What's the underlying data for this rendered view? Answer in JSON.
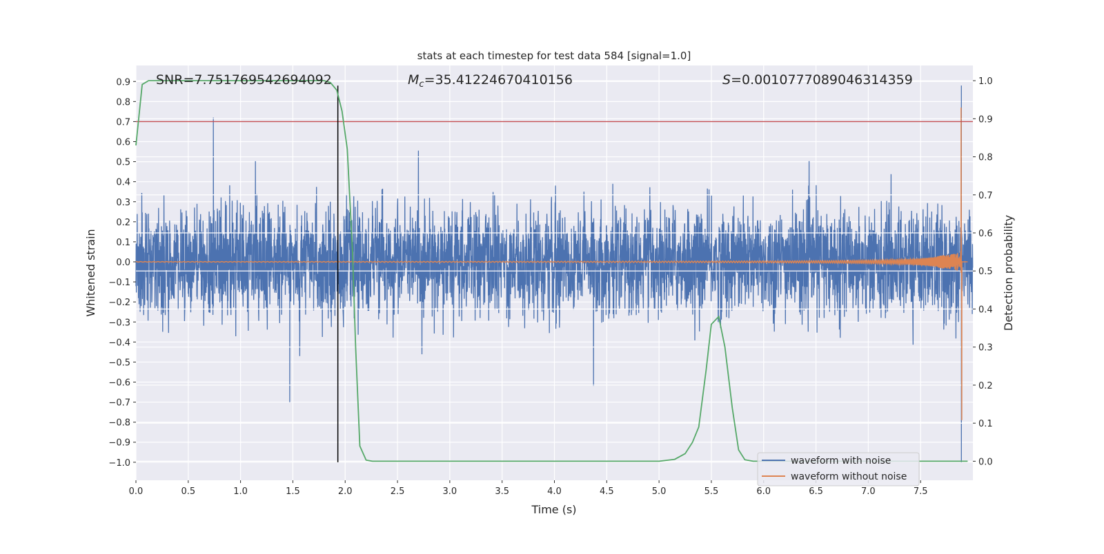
{
  "chart_data": {
    "type": "line",
    "title": "stats at each timestep for test data 584 [signal=1.0]",
    "xlabel": "Time (s)",
    "ylabel": "Whitened strain",
    "ylabel_right": "Detection probability",
    "xlim": [
      0,
      8
    ],
    "ylim": [
      -1.09,
      0.98
    ],
    "ylim_right": [
      -0.05,
      1.04
    ],
    "grid": true,
    "legend_position": "lower-right",
    "x_ticks": [
      "0.0",
      "0.5",
      "1.0",
      "1.5",
      "2.0",
      "2.5",
      "3.0",
      "3.5",
      "4.0",
      "4.5",
      "5.0",
      "5.5",
      "6.0",
      "6.5",
      "7.0",
      "7.5"
    ],
    "y_ticks": [
      "0.9",
      "0.8",
      "0.7",
      "0.6",
      "0.5",
      "0.4",
      "0.3",
      "0.2",
      "0.1",
      "0.0",
      "−0.1",
      "−0.2",
      "−0.3",
      "−0.4",
      "−0.5",
      "−0.6",
      "−0.7",
      "−0.8",
      "−0.9",
      "−1.0"
    ],
    "y_ticks_right": [
      "1.0",
      "0.9",
      "0.8",
      "0.7",
      "0.6",
      "0.5",
      "0.4",
      "0.3",
      "0.2",
      "0.1",
      "0.0"
    ],
    "annotations": {
      "snr": "SNR=7.751769542694092",
      "mc_symbol": "M",
      "mc_sub": "c",
      "mc_value": "=35.41224670410156",
      "s_symbol": "S",
      "s_value": "=0.0010777089046314359"
    },
    "series": [
      {
        "name": "waveform with noise",
        "color": "#4c72b0",
        "noise_std": 0.13,
        "notable_spikes": [
          [
            0.74,
            0.72
          ],
          [
            1.47,
            -0.7
          ],
          [
            7.89,
            0.88
          ],
          [
            7.89,
            -1.0
          ]
        ]
      },
      {
        "name": "waveform without noise",
        "color": "#dd8452",
        "merger_time": 7.89,
        "peak": 0.77,
        "trough": -0.79
      },
      {
        "color": "#55a868",
        "axis": "right",
        "x": [
          0.0,
          0.06,
          0.12,
          0.5,
          1.0,
          1.5,
          1.8,
          1.86,
          1.92,
          1.97,
          2.02,
          2.07,
          2.1,
          2.14,
          2.2,
          2.26,
          3.0,
          4.0,
          5.0,
          5.15,
          5.25,
          5.32,
          5.38,
          5.45,
          5.5,
          5.57,
          5.63,
          5.7,
          5.76,
          5.82,
          5.9,
          7.0,
          7.95
        ],
        "values": [
          0.83,
          0.99,
          1.0,
          1.0,
          1.0,
          1.0,
          1.0,
          0.995,
          0.975,
          0.92,
          0.82,
          0.55,
          0.3,
          0.04,
          0.003,
          0.0,
          0.0,
          0.0,
          0.0,
          0.005,
          0.02,
          0.05,
          0.09,
          0.24,
          0.36,
          0.38,
          0.3,
          0.14,
          0.03,
          0.004,
          0.0,
          0.0,
          0.0
        ]
      },
      {
        "color": "#c44e52",
        "type": "hline",
        "value": 0.7
      }
    ],
    "vline": {
      "x": 1.93,
      "ymin": -1.0,
      "ymax": 0.9,
      "color": "#000000"
    }
  }
}
